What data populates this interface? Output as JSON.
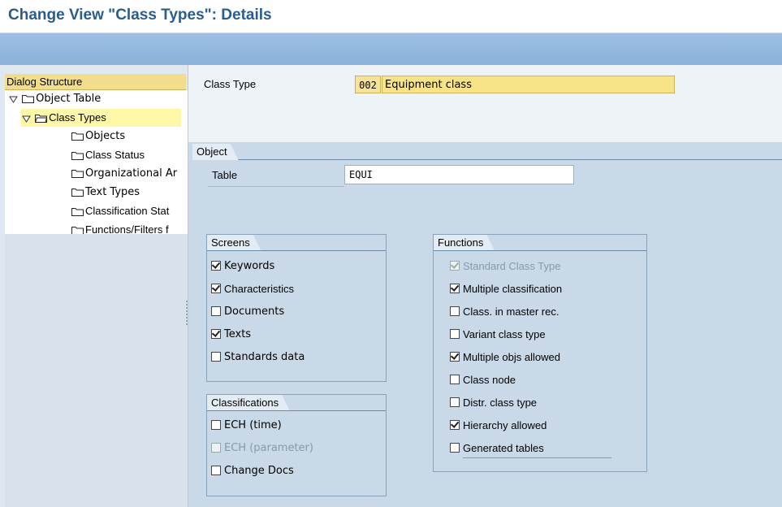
{
  "window": {
    "title": "Change View \"Class Types\": Details"
  },
  "nav": {
    "header": "Dialog Structure",
    "items": [
      {
        "label": "Object Table"
      },
      {
        "label": "Class Types"
      },
      {
        "label": "Objects"
      },
      {
        "label": "Class Status"
      },
      {
        "label": "Organizational Ar"
      },
      {
        "label": "Text Types"
      },
      {
        "label": "Classification Stat"
      },
      {
        "label": "Functions/Filters f"
      }
    ]
  },
  "header": {
    "class_type_label": "Class Type",
    "class_type_code": "002",
    "class_type_desc": "Equipment class"
  },
  "object": {
    "group_title": "Object",
    "table_label": "Table",
    "table_value": "EQUI"
  },
  "screens": {
    "group_title": "Screens",
    "items": [
      {
        "label": "Keywords",
        "checked": true
      },
      {
        "label": "Characteristics",
        "checked": true
      },
      {
        "label": "Documents",
        "checked": false
      },
      {
        "label": "Texts",
        "checked": true
      },
      {
        "label": "Standards data",
        "checked": false
      }
    ]
  },
  "classifications": {
    "group_title": "Classifications",
    "items": [
      {
        "label": "ECH (time)",
        "checked": false,
        "disabled": false
      },
      {
        "label": "ECH (parameter)",
        "checked": false,
        "disabled": true
      },
      {
        "label": "Change Docs",
        "checked": false,
        "disabled": false
      }
    ]
  },
  "functions": {
    "group_title": "Functions",
    "items": [
      {
        "label": "Standard Class Type",
        "checked": true,
        "disabled": true
      },
      {
        "label": "Multiple classification",
        "checked": true,
        "disabled": false
      },
      {
        "label": "Class. in master rec.",
        "checked": false,
        "disabled": false
      },
      {
        "label": "Variant class type",
        "checked": false,
        "disabled": false
      },
      {
        "label": "Multiple objs allowed",
        "checked": true,
        "disabled": false
      },
      {
        "label": "Class node",
        "checked": false,
        "disabled": false
      },
      {
        "label": "Distr. class type",
        "checked": false,
        "disabled": false
      },
      {
        "label": "Hierarchy allowed",
        "checked": true,
        "disabled": false
      },
      {
        "label": "Generated tables",
        "checked": false,
        "disabled": false
      }
    ]
  }
}
